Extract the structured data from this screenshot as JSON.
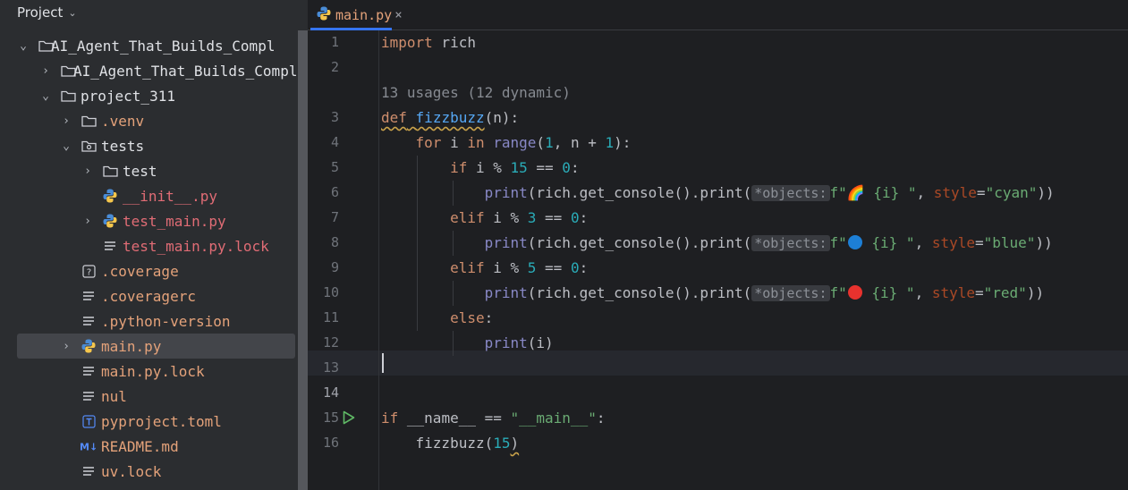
{
  "project_panel": {
    "title": "Project",
    "tree": [
      {
        "label": "AI_Agent_That_Builds_Compl",
        "type": "folder",
        "expanded": true
      },
      {
        "label": "AI_Agent_That_Builds_Compl",
        "type": "folder",
        "expanded": false
      },
      {
        "label": "project_311",
        "type": "folder",
        "expanded": true
      },
      {
        "label": ".venv",
        "type": "folder",
        "expanded": false
      },
      {
        "label": "tests",
        "type": "test-folder",
        "expanded": true
      },
      {
        "label": "test",
        "type": "folder",
        "expanded": false
      },
      {
        "label": "__init__.py",
        "type": "python"
      },
      {
        "label": "test_main.py",
        "type": "python",
        "expanded": false
      },
      {
        "label": "test_main.py.lock",
        "type": "text"
      },
      {
        "label": ".coverage",
        "type": "unknown"
      },
      {
        "label": ".coveragerc",
        "type": "text"
      },
      {
        "label": ".python-version",
        "type": "text"
      },
      {
        "label": "main.py",
        "type": "python",
        "expanded": false,
        "selected": true
      },
      {
        "label": "main.py.lock",
        "type": "text"
      },
      {
        "label": "nul",
        "type": "text"
      },
      {
        "label": "pyproject.toml",
        "type": "toml"
      },
      {
        "label": "README.md",
        "type": "markdown"
      },
      {
        "label": "uv.lock",
        "type": "text"
      }
    ]
  },
  "editor": {
    "tab": {
      "label": "main.py",
      "close": "×"
    },
    "usage_hint": "13 usages (12 dynamic)",
    "inlay_label": "*objects:",
    "emoji": {
      "rainbow": "🌈"
    },
    "colors": {
      "cyan_circle": "#1d7fd6",
      "red_circle": "#e8322e",
      "accent": "#3574f0"
    },
    "line_numbers": [
      "1",
      "2",
      "3",
      "4",
      "5",
      "6",
      "7",
      "8",
      "9",
      "10",
      "11",
      "12",
      "13",
      "14",
      "15",
      "16"
    ],
    "code": {
      "l1_import": "import",
      "l1_module": " rich",
      "l3_def": "def",
      "l3_name": "fizzbuzz",
      "l3_param": "n",
      "l4_for": "for",
      "l4_i": " i ",
      "l4_in": "in",
      "l4_range": "range",
      "l4_one": "1",
      "l4_mid": ", n + ",
      "l4_one_b": "1",
      "l5_if": "if",
      "l5_cond": " i % ",
      "l5_15": "15",
      "l5_eq": " == ",
      "l5_zero": "0",
      "l6_print": "print",
      "l6_call": "(rich.get_console().print(",
      "l6_f": "f\"",
      "l6_body": " {i} \"",
      "l6_style": "style",
      "l6_val": "\"cyan\"",
      "l7_elif": "elif",
      "l7_cond": " i % ",
      "l7_3": "3",
      "l7_eq": " == ",
      "l7_zero": "0",
      "l8_val": "\"blue\"",
      "l9_elif": "elif",
      "l9_cond": " i % ",
      "l9_5": "5",
      "l9_eq": " == ",
      "l9_zero": "0",
      "l10_val": "\"red\"",
      "l11_else": "else",
      "l12_print": "print",
      "l12_arg": "(i)",
      "l15_if": "if",
      "l15_name": "__name__",
      "l15_eq": " == ",
      "l15_str": "\"__main__\"",
      "l16_call": "fizzbuzz(",
      "l16_num": "15"
    }
  }
}
